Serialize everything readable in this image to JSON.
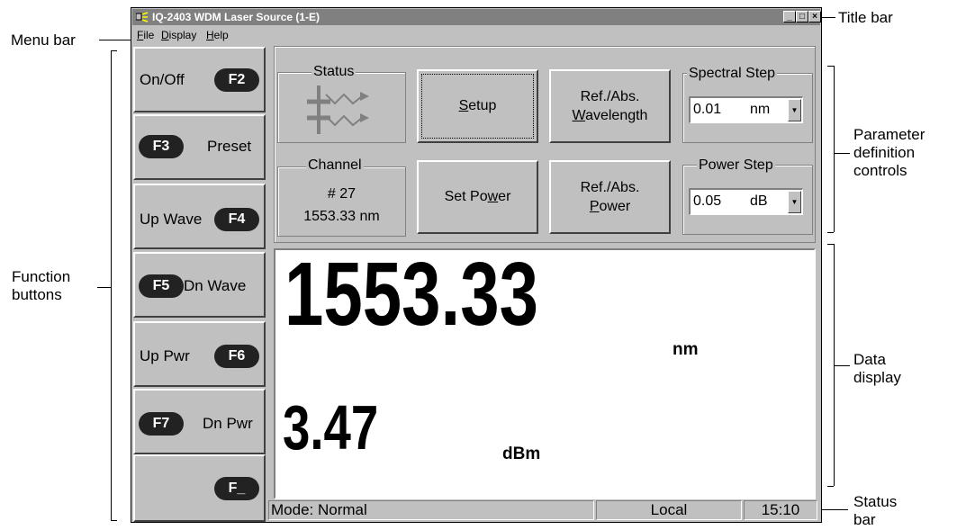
{
  "annotations": {
    "title_bar": "Title bar",
    "menu_bar": "Menu bar",
    "function_buttons": [
      "Function",
      "buttons"
    ],
    "parameter_controls": [
      "Parameter",
      "definition",
      "controls"
    ],
    "data_display": [
      "Data",
      "display"
    ],
    "status_bar": [
      "Status",
      "bar"
    ]
  },
  "window": {
    "title": "IQ-2403 WDM Laser Source  (1-E)",
    "controls": [
      "_",
      "□",
      "×"
    ]
  },
  "menu": {
    "items": [
      {
        "label": "File",
        "underline": "F"
      },
      {
        "label": "Display",
        "underline": "D"
      },
      {
        "label": "Help",
        "underline": "H"
      }
    ]
  },
  "function_buttons": [
    {
      "label": "On/Off",
      "key": "F2"
    },
    {
      "label": "Preset",
      "key": "F3"
    },
    {
      "label": "Up Wave",
      "key": "F4"
    },
    {
      "label": "Dn Wave",
      "key": "F5"
    },
    {
      "label": "Up Pwr",
      "key": "F6"
    },
    {
      "label": "Dn Pwr",
      "key": "F7"
    },
    {
      "label": "",
      "key": "F_"
    }
  ],
  "status_group": {
    "label": "Status",
    "icon": "laser-output-icon"
  },
  "buttons": {
    "setup": "Setup",
    "ref_abs_wavelength": [
      "Ref./Abs.",
      "Wavelength"
    ],
    "set_power": "Set Power",
    "ref_abs_power": [
      "Ref./Abs.",
      "Power"
    ]
  },
  "channel": {
    "label": "Channel",
    "number": "# 27",
    "wavelength": "1553.33 nm"
  },
  "spectral_step": {
    "label": "Spectral Step",
    "value": "0.01",
    "unit": "nm"
  },
  "power_step": {
    "label": "Power Step",
    "value": "0.05",
    "unit": "dB"
  },
  "display": {
    "wavelength_value": "1553.33",
    "wavelength_unit": "nm",
    "power_value": "3.47",
    "power_unit": "dBm"
  },
  "status_bar": {
    "mode": "Mode: Normal",
    "control": "Local",
    "time": "15:10"
  },
  "colors": {
    "titlebar": "#808080",
    "face": "#c0c0c0",
    "display_bg": "#ffffff",
    "fkey": "#222222"
  }
}
